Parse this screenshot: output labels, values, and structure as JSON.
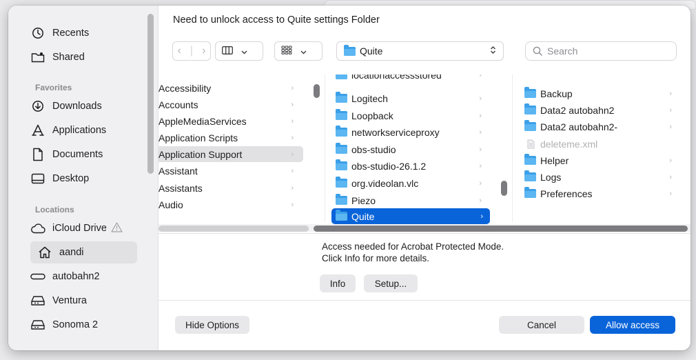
{
  "dialog": {
    "title": "Need to unlock access to Quite settings Folder"
  },
  "sidebar": {
    "recents": "Recents",
    "shared": "Shared",
    "favorites_header": "Favorites",
    "favorites": [
      "Downloads",
      "Applications",
      "Documents",
      "Desktop"
    ],
    "locations_header": "Locations",
    "locations": [
      "iCloud Drive",
      "aandi",
      "autobahn2",
      "Ventura",
      "Sonoma 2"
    ],
    "selected": "aandi"
  },
  "toolbar": {
    "path": "Quite",
    "search_placeholder": "Search"
  },
  "columns": {
    "col1": [
      "Accessibility",
      "Accounts",
      "AppleMediaServices",
      "Application Scripts",
      "Application Support",
      "Assistant",
      "Assistants",
      "Audio"
    ],
    "col1_selected": "Application Support",
    "col2_partial": "locationaccessstored",
    "col2": [
      "Logitech",
      "Loopback",
      "networkserviceproxy",
      "obs-studio",
      "obs-studio-26.1.2",
      "org.videolan.vlc",
      "Piezo",
      "Quite"
    ],
    "col2_selected": "Quite",
    "col3": [
      {
        "name": "Backup",
        "type": "folder"
      },
      {
        "name": "Data2 autobahn2",
        "type": "folder"
      },
      {
        "name": "Data2 autobahn2-",
        "type": "folder"
      },
      {
        "name": "deleteme.xml",
        "type": "file"
      },
      {
        "name": "Helper",
        "type": "folder"
      },
      {
        "name": "Logs",
        "type": "folder"
      },
      {
        "name": "Preferences",
        "type": "folder"
      }
    ]
  },
  "info": {
    "line1": "Access needed for Acrobat Protected Mode.",
    "line2": "Click Info for more details.",
    "info_button": "Info",
    "setup_button": "Setup..."
  },
  "footer": {
    "hide_options": "Hide Options",
    "cancel": "Cancel",
    "allow": "Allow access"
  },
  "colors": {
    "accent": "#0a64d9",
    "folder": "#5bb6f2"
  }
}
